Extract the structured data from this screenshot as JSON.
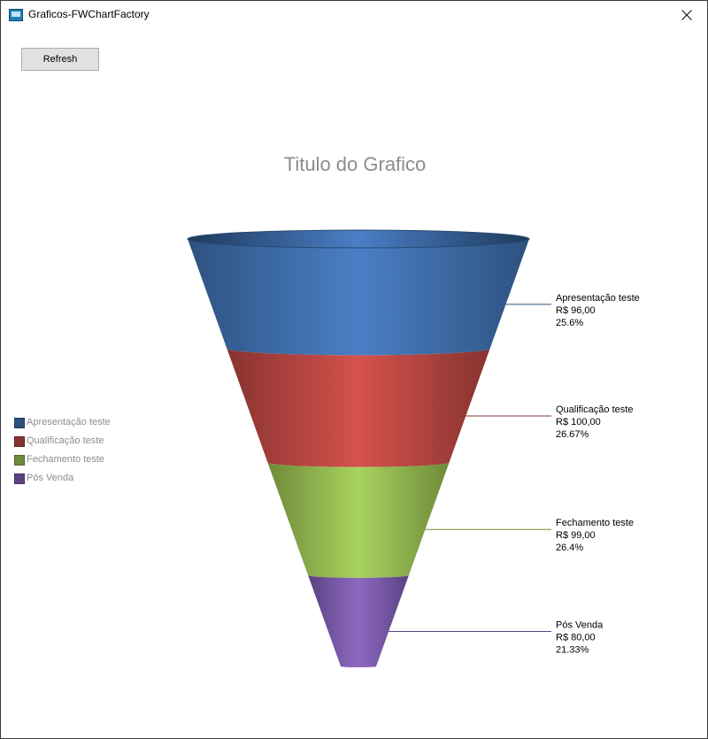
{
  "window": {
    "title": "Graficos-FWChartFactory",
    "close_symbol": "×"
  },
  "toolbar": {
    "refresh_label": "Refresh"
  },
  "colors": {
    "chart_title": "#8c8c8c",
    "legend_text": "#8c8c8c"
  },
  "chart_data": {
    "type": "funnel",
    "title": "Titulo do Grafico",
    "legend_position": "left",
    "stages": [
      {
        "name": "Apresentação teste",
        "value": 96,
        "value_label": "R$ 96,00",
        "percent_label": "25.6%",
        "color": "#4a7fc6",
        "dark": "#2d527f"
      },
      {
        "name": "Qualificação teste",
        "value": 100,
        "value_label": "R$ 100,00",
        "percent_label": "26.67%",
        "color": "#d4524c",
        "dark": "#873330"
      },
      {
        "name": "Fechamento teste",
        "value": 99,
        "value_label": "R$ 99,00",
        "percent_label": "26.4%",
        "color": "#a8d45e",
        "dark": "#6e8a3a"
      },
      {
        "name": "Pós Venda",
        "value": 80,
        "value_label": "R$ 80,00",
        "percent_label": "21.33%",
        "color": "#8e6ac0",
        "dark": "#5b4282"
      }
    ]
  }
}
